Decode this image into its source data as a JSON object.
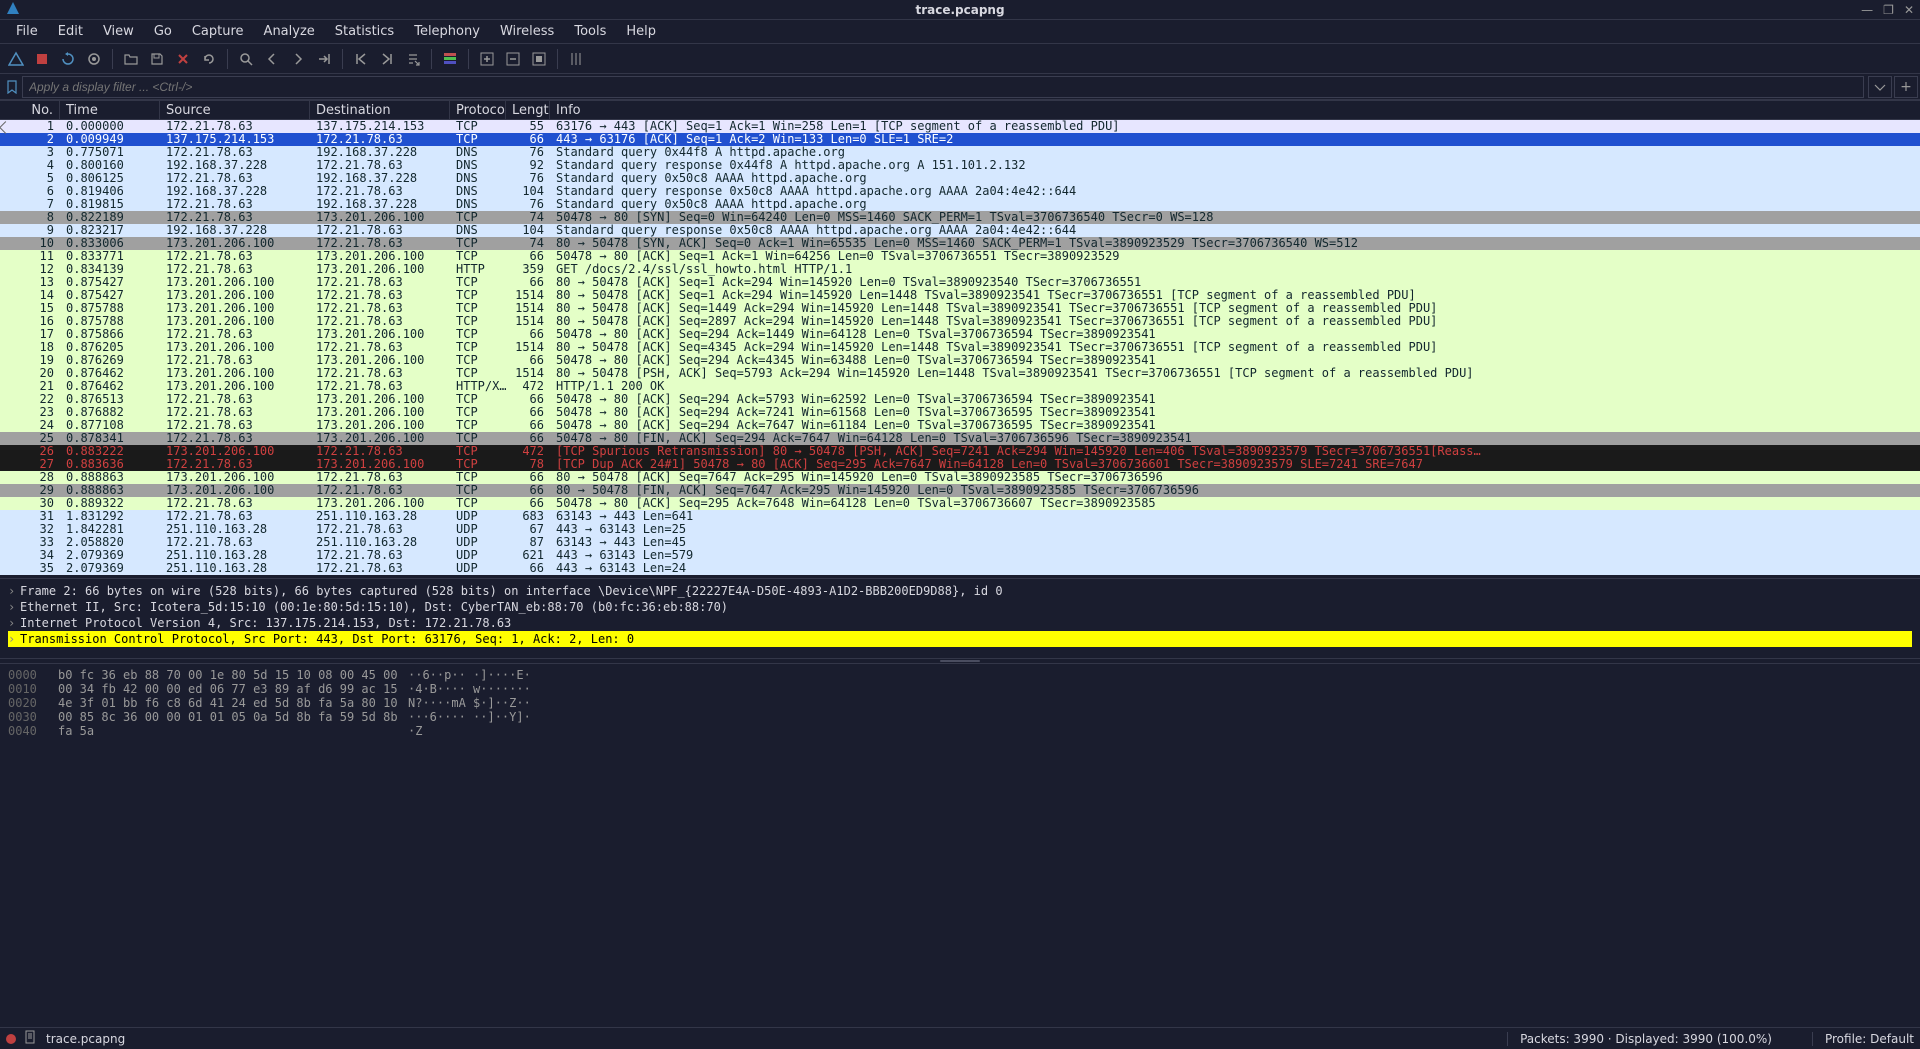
{
  "window": {
    "title": "trace.pcapng"
  },
  "menubar": [
    "File",
    "Edit",
    "View",
    "Go",
    "Capture",
    "Analyze",
    "Statistics",
    "Telephony",
    "Wireless",
    "Tools",
    "Help"
  ],
  "filter": {
    "placeholder": "Apply a display filter ... <Ctrl-/>"
  },
  "packet_list": {
    "columns": [
      "No.",
      "Time",
      "Source",
      "Destination",
      "Protocol",
      "Length",
      "Info"
    ],
    "rows": [
      {
        "no": "1",
        "time": "0.000000",
        "src": "172.21.78.63",
        "dst": "137.175.214.153",
        "proto": "TCP",
        "len": "55",
        "info": "63176 → 443 [ACK] Seq=1 Ack=1 Win=258 Len=1 [TCP segment of a reassembled PDU]",
        "cls": "c-tcp-light",
        "mark": true
      },
      {
        "no": "2",
        "time": "0.009949",
        "src": "137.175.214.153",
        "dst": "172.21.78.63",
        "proto": "TCP",
        "len": "66",
        "info": "443 → 63176 [ACK] Seq=1 Ack=2 Win=133 Len=0 SLE=1 SRE=2",
        "cls": "c-tcp-sel"
      },
      {
        "no": "3",
        "time": "0.775071",
        "src": "172.21.78.63",
        "dst": "192.168.37.228",
        "proto": "DNS",
        "len": "76",
        "info": "Standard query 0x44f8 A httpd.apache.org",
        "cls": "c-dns"
      },
      {
        "no": "4",
        "time": "0.800160",
        "src": "192.168.37.228",
        "dst": "172.21.78.63",
        "proto": "DNS",
        "len": "92",
        "info": "Standard query response 0x44f8 A httpd.apache.org A 151.101.2.132",
        "cls": "c-dns"
      },
      {
        "no": "5",
        "time": "0.806125",
        "src": "172.21.78.63",
        "dst": "192.168.37.228",
        "proto": "DNS",
        "len": "76",
        "info": "Standard query 0x50c8 AAAA httpd.apache.org",
        "cls": "c-dns"
      },
      {
        "no": "6",
        "time": "0.819406",
        "src": "192.168.37.228",
        "dst": "172.21.78.63",
        "proto": "DNS",
        "len": "104",
        "info": "Standard query response 0x50c8 AAAA httpd.apache.org AAAA 2a04:4e42::644",
        "cls": "c-dns"
      },
      {
        "no": "7",
        "time": "0.819815",
        "src": "172.21.78.63",
        "dst": "192.168.37.228",
        "proto": "DNS",
        "len": "76",
        "info": "Standard query 0x50c8 AAAA httpd.apache.org",
        "cls": "c-dns"
      },
      {
        "no": "8",
        "time": "0.822189",
        "src": "172.21.78.63",
        "dst": "173.201.206.100",
        "proto": "TCP",
        "len": "74",
        "info": "50478 → 80 [SYN] Seq=0 Win=64240 Len=0 MSS=1460 SACK_PERM=1 TSval=3706736540 TSecr=0 WS=128",
        "cls": "c-syn"
      },
      {
        "no": "9",
        "time": "0.823217",
        "src": "192.168.37.228",
        "dst": "172.21.78.63",
        "proto": "DNS",
        "len": "104",
        "info": "Standard query response 0x50c8 AAAA httpd.apache.org AAAA 2a04:4e42::644",
        "cls": "c-dns"
      },
      {
        "no": "10",
        "time": "0.833006",
        "src": "173.201.206.100",
        "dst": "172.21.78.63",
        "proto": "TCP",
        "len": "74",
        "info": "80 → 50478 [SYN, ACK] Seq=0 Ack=1 Win=65535 Len=0 MSS=1460 SACK_PERM=1 TSval=3890923529 TSecr=3706736540 WS=512",
        "cls": "c-syn"
      },
      {
        "no": "11",
        "time": "0.833771",
        "src": "172.21.78.63",
        "dst": "173.201.206.100",
        "proto": "TCP",
        "len": "66",
        "info": "50478 → 80 [ACK] Seq=1 Ack=1 Win=64256 Len=0 TSval=3706736551 TSecr=3890923529",
        "cls": "c-http"
      },
      {
        "no": "12",
        "time": "0.834139",
        "src": "172.21.78.63",
        "dst": "173.201.206.100",
        "proto": "HTTP",
        "len": "359",
        "info": "GET /docs/2.4/ssl/ssl_howto.html HTTP/1.1",
        "cls": "c-http"
      },
      {
        "no": "13",
        "time": "0.875427",
        "src": "173.201.206.100",
        "dst": "172.21.78.63",
        "proto": "TCP",
        "len": "66",
        "info": "80 → 50478 [ACK] Seq=1 Ack=294 Win=145920 Len=0 TSval=3890923540 TSecr=3706736551",
        "cls": "c-http"
      },
      {
        "no": "14",
        "time": "0.875427",
        "src": "173.201.206.100",
        "dst": "172.21.78.63",
        "proto": "TCP",
        "len": "1514",
        "info": "80 → 50478 [ACK] Seq=1 Ack=294 Win=145920 Len=1448 TSval=3890923541 TSecr=3706736551 [TCP segment of a reassembled PDU]",
        "cls": "c-http"
      },
      {
        "no": "15",
        "time": "0.875788",
        "src": "173.201.206.100",
        "dst": "172.21.78.63",
        "proto": "TCP",
        "len": "1514",
        "info": "80 → 50478 [ACK] Seq=1449 Ack=294 Win=145920 Len=1448 TSval=3890923541 TSecr=3706736551 [TCP segment of a reassembled PDU]",
        "cls": "c-http"
      },
      {
        "no": "16",
        "time": "0.875788",
        "src": "173.201.206.100",
        "dst": "172.21.78.63",
        "proto": "TCP",
        "len": "1514",
        "info": "80 → 50478 [ACK] Seq=2897 Ack=294 Win=145920 Len=1448 TSval=3890923541 TSecr=3706736551 [TCP segment of a reassembled PDU]",
        "cls": "c-http"
      },
      {
        "no": "17",
        "time": "0.875866",
        "src": "172.21.78.63",
        "dst": "173.201.206.100",
        "proto": "TCP",
        "len": "66",
        "info": "50478 → 80 [ACK] Seq=294 Ack=1449 Win=64128 Len=0 TSval=3706736594 TSecr=3890923541",
        "cls": "c-http"
      },
      {
        "no": "18",
        "time": "0.876205",
        "src": "173.201.206.100",
        "dst": "172.21.78.63",
        "proto": "TCP",
        "len": "1514",
        "info": "80 → 50478 [ACK] Seq=4345 Ack=294 Win=145920 Len=1448 TSval=3890923541 TSecr=3706736551 [TCP segment of a reassembled PDU]",
        "cls": "c-http"
      },
      {
        "no": "19",
        "time": "0.876269",
        "src": "172.21.78.63",
        "dst": "173.201.206.100",
        "proto": "TCP",
        "len": "66",
        "info": "50478 → 80 [ACK] Seq=294 Ack=4345 Win=63488 Len=0 TSval=3706736594 TSecr=3890923541",
        "cls": "c-http"
      },
      {
        "no": "20",
        "time": "0.876462",
        "src": "173.201.206.100",
        "dst": "172.21.78.63",
        "proto": "TCP",
        "len": "1514",
        "info": "80 → 50478 [PSH, ACK] Seq=5793 Ack=294 Win=145920 Len=1448 TSval=3890923541 TSecr=3706736551 [TCP segment of a reassembled PDU]",
        "cls": "c-http"
      },
      {
        "no": "21",
        "time": "0.876462",
        "src": "173.201.206.100",
        "dst": "172.21.78.63",
        "proto": "HTTP/X…",
        "len": "472",
        "info": "HTTP/1.1 200 OK",
        "cls": "c-http"
      },
      {
        "no": "22",
        "time": "0.876513",
        "src": "172.21.78.63",
        "dst": "173.201.206.100",
        "proto": "TCP",
        "len": "66",
        "info": "50478 → 80 [ACK] Seq=294 Ack=5793 Win=62592 Len=0 TSval=3706736594 TSecr=3890923541",
        "cls": "c-http"
      },
      {
        "no": "23",
        "time": "0.876882",
        "src": "172.21.78.63",
        "dst": "173.201.206.100",
        "proto": "TCP",
        "len": "66",
        "info": "50478 → 80 [ACK] Seq=294 Ack=7241 Win=61568 Len=0 TSval=3706736595 TSecr=3890923541",
        "cls": "c-http"
      },
      {
        "no": "24",
        "time": "0.877108",
        "src": "172.21.78.63",
        "dst": "173.201.206.100",
        "proto": "TCP",
        "len": "66",
        "info": "50478 → 80 [ACK] Seq=294 Ack=7647 Win=61184 Len=0 TSval=3706736595 TSecr=3890923541",
        "cls": "c-http"
      },
      {
        "no": "25",
        "time": "0.878341",
        "src": "172.21.78.63",
        "dst": "173.201.206.100",
        "proto": "TCP",
        "len": "66",
        "info": "50478 → 80 [FIN, ACK] Seq=294 Ack=7647 Win=64128 Len=0 TSval=3706736596 TSecr=3890923541",
        "cls": "c-syn"
      },
      {
        "no": "26",
        "time": "0.883222",
        "src": "173.201.206.100",
        "dst": "172.21.78.63",
        "proto": "TCP",
        "len": "472",
        "info": "[TCP Spurious Retransmission] 80 → 50478 [PSH, ACK] Seq=7241 Ack=294 Win=145920 Len=406 TSval=3890923579 TSecr=3706736551[Reass…",
        "cls": "c-bad"
      },
      {
        "no": "27",
        "time": "0.883636",
        "src": "172.21.78.63",
        "dst": "173.201.206.100",
        "proto": "TCP",
        "len": "78",
        "info": "[TCP Dup ACK 24#1] 50478 → 80 [ACK] Seq=295 Ack=7647 Win=64128 Len=0 TSval=3706736601 TSecr=3890923579 SLE=7241 SRE=7647",
        "cls": "c-bad"
      },
      {
        "no": "28",
        "time": "0.888863",
        "src": "173.201.206.100",
        "dst": "172.21.78.63",
        "proto": "TCP",
        "len": "66",
        "info": "80 → 50478 [ACK] Seq=7647 Ack=295 Win=145920 Len=0 TSval=3890923585 TSecr=3706736596",
        "cls": "c-http"
      },
      {
        "no": "29",
        "time": "0.888863",
        "src": "173.201.206.100",
        "dst": "172.21.78.63",
        "proto": "TCP",
        "len": "66",
        "info": "80 → 50478 [FIN, ACK] Seq=7647 Ack=295 Win=145920 Len=0 TSval=3890923585 TSecr=3706736596",
        "cls": "c-syn"
      },
      {
        "no": "30",
        "time": "0.889322",
        "src": "172.21.78.63",
        "dst": "173.201.206.100",
        "proto": "TCP",
        "len": "66",
        "info": "50478 → 80 [ACK] Seq=295 Ack=7648 Win=64128 Len=0 TSval=3706736607 TSecr=3890923585",
        "cls": "c-http"
      },
      {
        "no": "31",
        "time": "1.831292",
        "src": "172.21.78.63",
        "dst": "251.110.163.28",
        "proto": "UDP",
        "len": "683",
        "info": "63143 → 443 Len=641",
        "cls": "c-udp"
      },
      {
        "no": "32",
        "time": "1.842281",
        "src": "251.110.163.28",
        "dst": "172.21.78.63",
        "proto": "UDP",
        "len": "67",
        "info": "443 → 63143 Len=25",
        "cls": "c-udp"
      },
      {
        "no": "33",
        "time": "2.058820",
        "src": "172.21.78.63",
        "dst": "251.110.163.28",
        "proto": "UDP",
        "len": "87",
        "info": "63143 → 443 Len=45",
        "cls": "c-udp"
      },
      {
        "no": "34",
        "time": "2.079369",
        "src": "251.110.163.28",
        "dst": "172.21.78.63",
        "proto": "UDP",
        "len": "621",
        "info": "443 → 63143 Len=579",
        "cls": "c-udp"
      },
      {
        "no": "35",
        "time": "2.079369",
        "src": "251.110.163.28",
        "dst": "172.21.78.63",
        "proto": "UDP",
        "len": "66",
        "info": "443 → 63143 Len=24",
        "cls": "c-udp"
      }
    ]
  },
  "details": [
    {
      "text": "Frame 2: 66 bytes on wire (528 bits), 66 bytes captured (528 bits) on interface \\Device\\NPF_{22227E4A-D50E-4893-A1D2-BBB200ED9D88}, id 0",
      "hl": false
    },
    {
      "text": "Ethernet II, Src: Icotera_5d:15:10 (00:1e:80:5d:15:10), Dst: CyberTAN_eb:88:70 (b0:fc:36:eb:88:70)",
      "hl": false
    },
    {
      "text": "Internet Protocol Version 4, Src: 137.175.214.153, Dst: 172.21.78.63",
      "hl": false
    },
    {
      "text": "Transmission Control Protocol, Src Port: 443, Dst Port: 63176, Seq: 1, Ack: 2, Len: 0",
      "hl": true
    }
  ],
  "hex": [
    {
      "off": "0000",
      "bytes": "b0 fc 36 eb 88 70 00 1e   80 5d 15 10 08 00 45 00",
      "ascii": "··6··p··  ·]····E·"
    },
    {
      "off": "0010",
      "bytes": "00 34 fb 42 00 00 ed 06   77 e3 89 af d6 99 ac 15",
      "ascii": "·4·B····  w·······"
    },
    {
      "off": "0020",
      "bytes": "4e 3f 01 bb f6 c8 6d 41   24 ed 5d 8b fa 5a 80 10",
      "ascii": "N?····mA  $·]··Z··"
    },
    {
      "off": "0030",
      "bytes": "00 85 8c 36 00 00 01 01   05 0a 5d 8b fa 59 5d 8b",
      "ascii": "···6····  ··]··Y]·"
    },
    {
      "off": "0040",
      "bytes": "fa 5a",
      "ascii": "·Z"
    }
  ],
  "statusbar": {
    "file": "trace.pcapng",
    "packets": "Packets: 3990 · Displayed: 3990 (100.0%)",
    "profile": "Profile: Default"
  }
}
